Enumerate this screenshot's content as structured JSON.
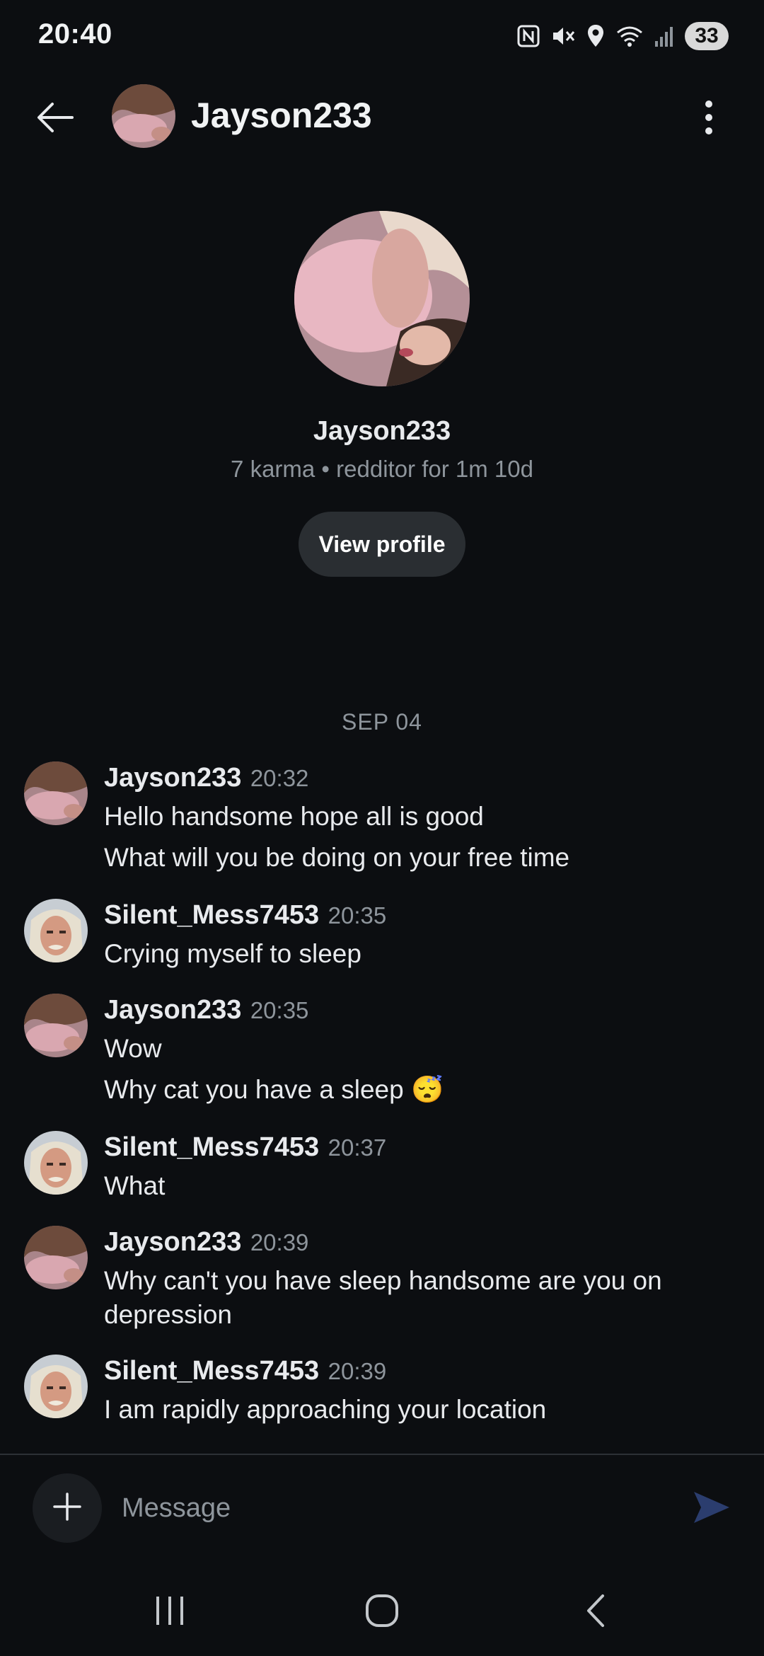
{
  "status_bar": {
    "time": "20:40",
    "battery": "33",
    "icons": [
      "nfc-icon",
      "mute-icon",
      "location-icon",
      "wifi-icon",
      "signal-icon",
      "battery-icon"
    ]
  },
  "header": {
    "title": "Jayson233",
    "back_icon": "arrow-left-icon",
    "menu_icon": "more-vertical-icon"
  },
  "profile": {
    "name": "Jayson233",
    "meta": "7 karma • redditor for 1m 10d",
    "view_profile_label": "View profile"
  },
  "date_divider": "SEP 04",
  "messages": [
    {
      "author": "Jayson233",
      "time": "20:32",
      "lines": [
        "Hello handsome hope all is good",
        "What will you be doing on your free time"
      ]
    },
    {
      "author": "Silent_Mess7453",
      "time": "20:35",
      "lines": [
        "Crying myself to sleep"
      ]
    },
    {
      "author": "Jayson233",
      "time": "20:35",
      "lines": [
        "Wow",
        "Why cat you have a sleep 😴"
      ]
    },
    {
      "author": "Silent_Mess7453",
      "time": "20:37",
      "lines": [
        "What"
      ]
    },
    {
      "author": "Jayson233",
      "time": "20:39",
      "lines": [
        "Why can't you have sleep handsome are you on depression"
      ]
    },
    {
      "author": "Silent_Mess7453",
      "time": "20:39",
      "lines": [
        "I am rapidly approaching your location"
      ]
    }
  ],
  "composer": {
    "placeholder": "Message",
    "add_icon": "plus-icon",
    "send_icon": "send-icon"
  },
  "nav_bar": {
    "icons": [
      "recents-icon",
      "home-icon",
      "back-icon"
    ]
  },
  "colors": {
    "background": "#0c0e11",
    "text_primary": "#e8eaed",
    "text_secondary": "#8e959c",
    "button_bg": "#2a2e32",
    "send_accent": "#2b3d6e"
  }
}
